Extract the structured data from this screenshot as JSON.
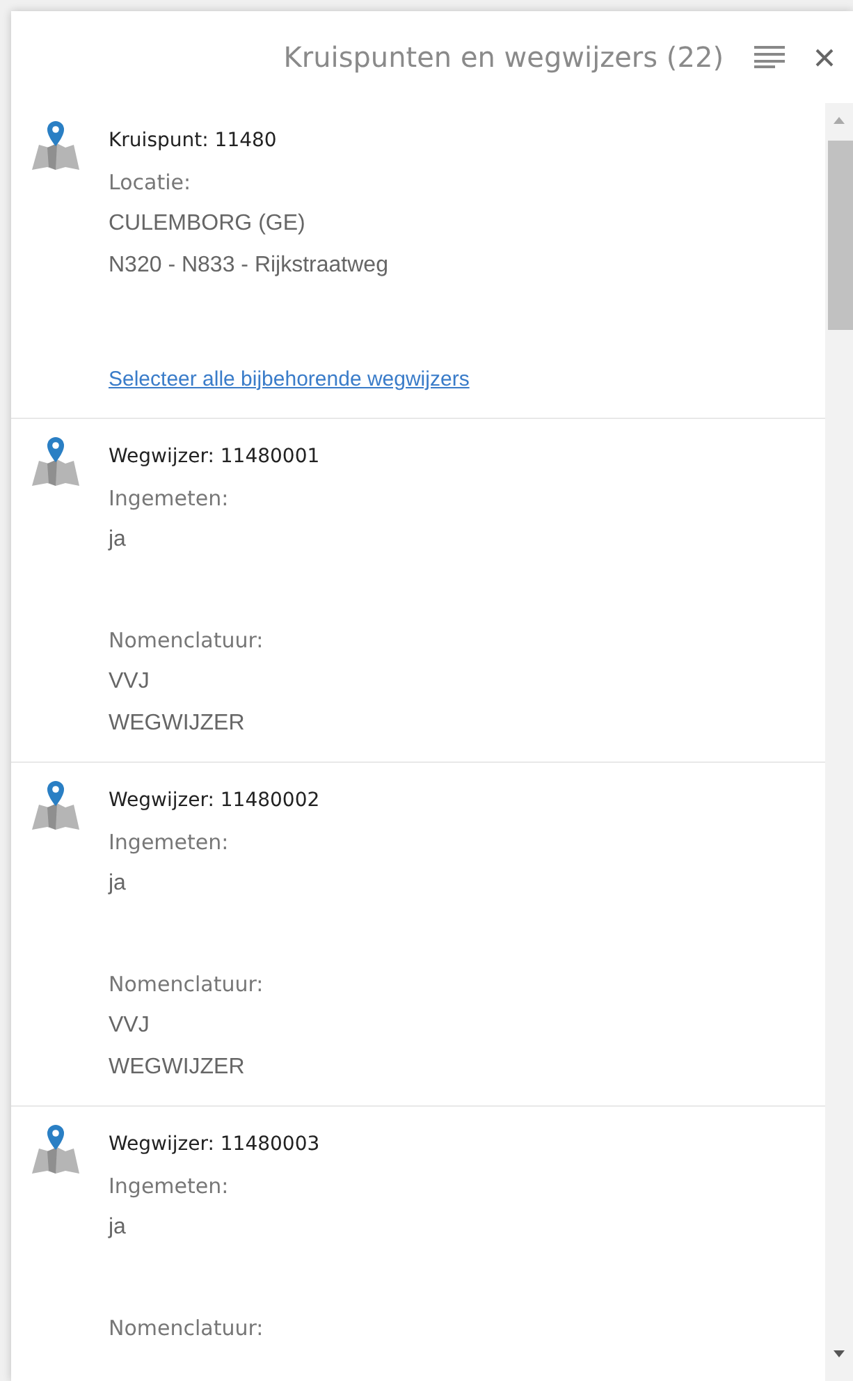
{
  "panel": {
    "title": "Kruispunten en wegwijzers (22)"
  },
  "items": [
    {
      "title": "Kruispunt: 11480",
      "fields": [
        {
          "label": "Locatie:",
          "values": [
            "CULEMBORG (GE)",
            "N320 - N833 - Rijkstraatweg"
          ]
        }
      ],
      "link": "Selecteer alle bijbehorende wegwijzers"
    },
    {
      "title": "Wegwijzer: 11480001",
      "fields": [
        {
          "label": "Ingemeten:",
          "values": [
            "ja"
          ]
        },
        {
          "label": "Nomenclatuur:",
          "values": [
            "VVJ",
            "WEGWIJZER"
          ]
        }
      ]
    },
    {
      "title": "Wegwijzer: 11480002",
      "fields": [
        {
          "label": "Ingemeten:",
          "values": [
            "ja"
          ]
        },
        {
          "label": "Nomenclatuur:",
          "values": [
            "VVJ",
            "WEGWIJZER"
          ]
        }
      ]
    },
    {
      "title": "Wegwijzer: 11480003",
      "fields": [
        {
          "label": "Ingemeten:",
          "values": [
            "ja"
          ]
        },
        {
          "label": "Nomenclatuur:"
        }
      ]
    }
  ]
}
